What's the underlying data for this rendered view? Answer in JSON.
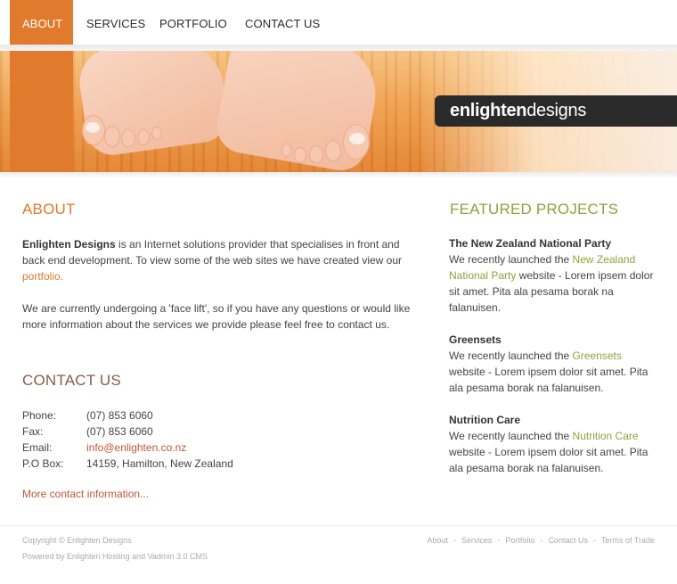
{
  "nav": {
    "items": [
      {
        "label": "ABOUT",
        "active": true
      },
      {
        "label": "SERVICES",
        "active": false
      },
      {
        "label": "PORTFOLIO",
        "active": false
      },
      {
        "label": "CONTACT US",
        "active": false
      }
    ]
  },
  "banner": {
    "logo_bold": "enlighten",
    "logo_light": "designs"
  },
  "about": {
    "heading": "ABOUT",
    "p1_bold": "Enlighten Designs",
    "p1_text": " is an Internet solutions provider that specialises in front and back end development. To view some of the web sites we have created view our ",
    "p1_link": "portfolio.",
    "p2": "We are currently undergoing a 'face lift', so if you have any questions or would like more information about the services we provide please feel free to contact us."
  },
  "contact": {
    "heading": "CONTACT US",
    "rows": [
      {
        "label": "Phone:",
        "value": "(07) 853 6060"
      },
      {
        "label": "Fax:",
        "value": "(07) 853 6060"
      },
      {
        "label": "Email:",
        "value": "info@enlighten.co.nz"
      },
      {
        "label": "P.O Box:",
        "value": "14159, Hamilton, New Zealand"
      }
    ],
    "more_link": "More contact information..."
  },
  "featured": {
    "heading": "FEATURED PROJECTS",
    "projects": [
      {
        "title": "The New Zealand National Party",
        "pre": "We recently launched the ",
        "link": "New Zealand National Party",
        "post": " website - Lorem ipsem dolor sit amet.  Pita ala pesama borak na falanuisen."
      },
      {
        "title": "Greensets",
        "pre": "We recently launched the ",
        "link": "Greensets",
        "post": " website - Lorem ipsem dolor sit amet. Pita ala pesama borak na falanuisen."
      },
      {
        "title": "Nutrition Care",
        "pre": "We recently launched the ",
        "link": "Nutrition Care",
        "post": " website - Lorem ipsem dolor sit amet. Pita ala pesama borak na falanuisen."
      }
    ]
  },
  "footer": {
    "copyright": "Copyright © Enlighten Designs",
    "powered": "Powered by Enlighten Hosting and Vadmin 3.0 CMS",
    "links": [
      "About",
      "Services",
      "Portfolio",
      "Contact Us",
      "Terms of Trade"
    ],
    "separator": "-"
  },
  "colors": {
    "accent_orange": "#e07a2c",
    "accent_green": "#8da33a",
    "contact_heading": "#8a5a4a",
    "link_red": "#c4543a"
  }
}
